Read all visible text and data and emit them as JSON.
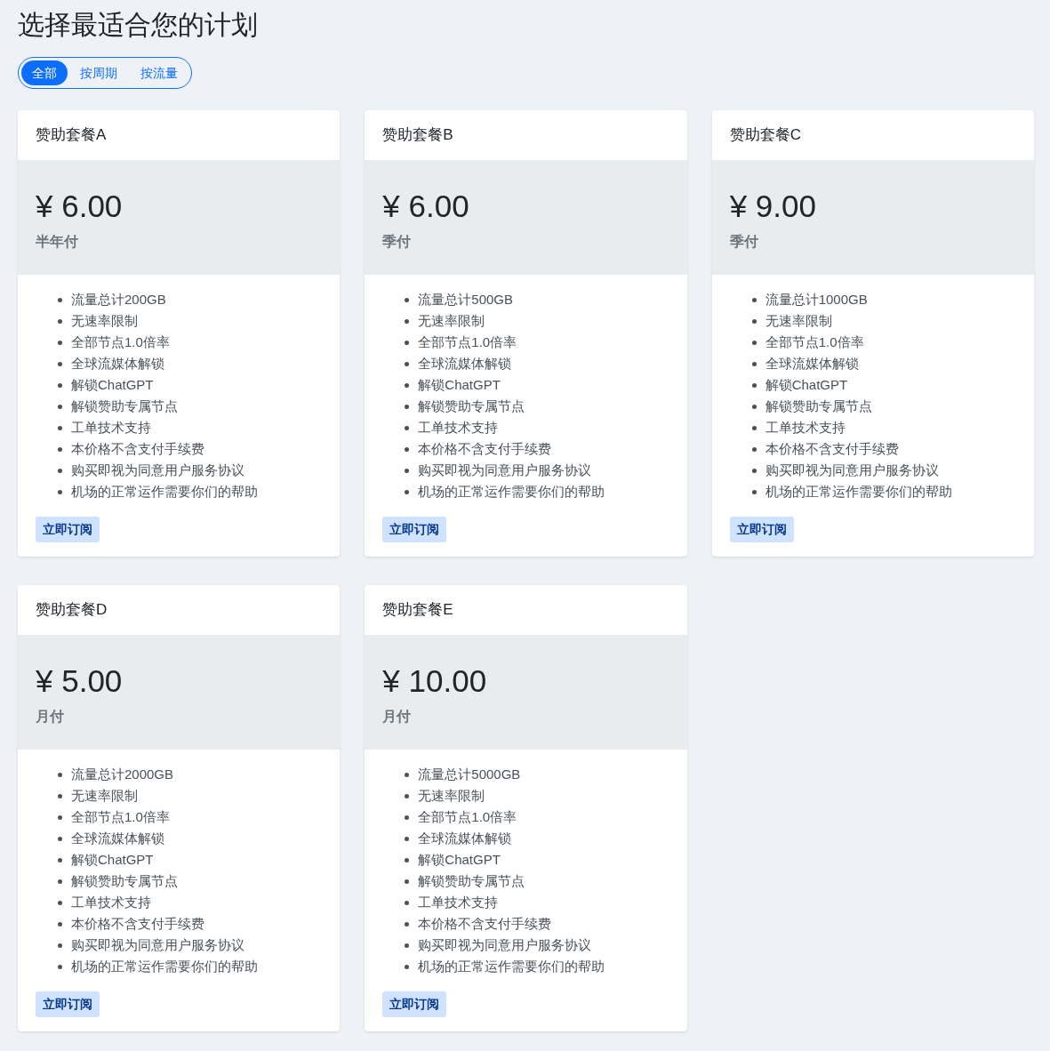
{
  "title": "选择最适合您的计划",
  "filters": [
    {
      "label": "全部",
      "selected": true
    },
    {
      "label": "按周期",
      "selected": false
    },
    {
      "label": "按流量",
      "selected": false
    }
  ],
  "plans": [
    {
      "name": "赞助套餐A",
      "price": "¥ 6.00",
      "period": "半年付",
      "features": [
        "流量总计200GB",
        "无速率限制",
        "全部节点1.0倍率",
        "全球流媒体解锁",
        "解锁ChatGPT",
        "解锁赞助专属节点",
        "工单技术支持",
        "本价格不含支付手续费",
        "购买即视为同意用户服务协议",
        "机场的正常运作需要你们的帮助"
      ],
      "button": "立即订阅"
    },
    {
      "name": "赞助套餐B",
      "price": "¥ 6.00",
      "period": "季付",
      "features": [
        "流量总计500GB",
        "无速率限制",
        "全部节点1.0倍率",
        "全球流媒体解锁",
        "解锁ChatGPT",
        "解锁赞助专属节点",
        "工单技术支持",
        "本价格不含支付手续费",
        "购买即视为同意用户服务协议",
        "机场的正常运作需要你们的帮助"
      ],
      "button": "立即订阅"
    },
    {
      "name": "赞助套餐C",
      "price": "¥ 9.00",
      "period": "季付",
      "features": [
        "流量总计1000GB",
        "无速率限制",
        "全部节点1.0倍率",
        "全球流媒体解锁",
        "解锁ChatGPT",
        "解锁赞助专属节点",
        "工单技术支持",
        "本价格不含支付手续费",
        "购买即视为同意用户服务协议",
        "机场的正常运作需要你们的帮助"
      ],
      "button": "立即订阅"
    },
    {
      "name": "赞助套餐D",
      "price": "¥ 5.00",
      "period": "月付",
      "features": [
        "流量总计2000GB",
        "无速率限制",
        "全部节点1.0倍率",
        "全球流媒体解锁",
        "解锁ChatGPT",
        "解锁赞助专属节点",
        "工单技术支持",
        "本价格不含支付手续费",
        "购买即视为同意用户服务协议",
        "机场的正常运作需要你们的帮助"
      ],
      "button": "立即订阅"
    },
    {
      "name": "赞助套餐E",
      "price": "¥ 10.00",
      "period": "月付",
      "features": [
        "流量总计5000GB",
        "无速率限制",
        "全部节点1.0倍率",
        "全球流媒体解锁",
        "解锁ChatGPT",
        "解锁赞助专属节点",
        "工单技术支持",
        "本价格不含支付手续费",
        "购买即视为同意用户服务协议",
        "机场的正常运作需要你们的帮助"
      ],
      "button": "立即订阅"
    }
  ]
}
